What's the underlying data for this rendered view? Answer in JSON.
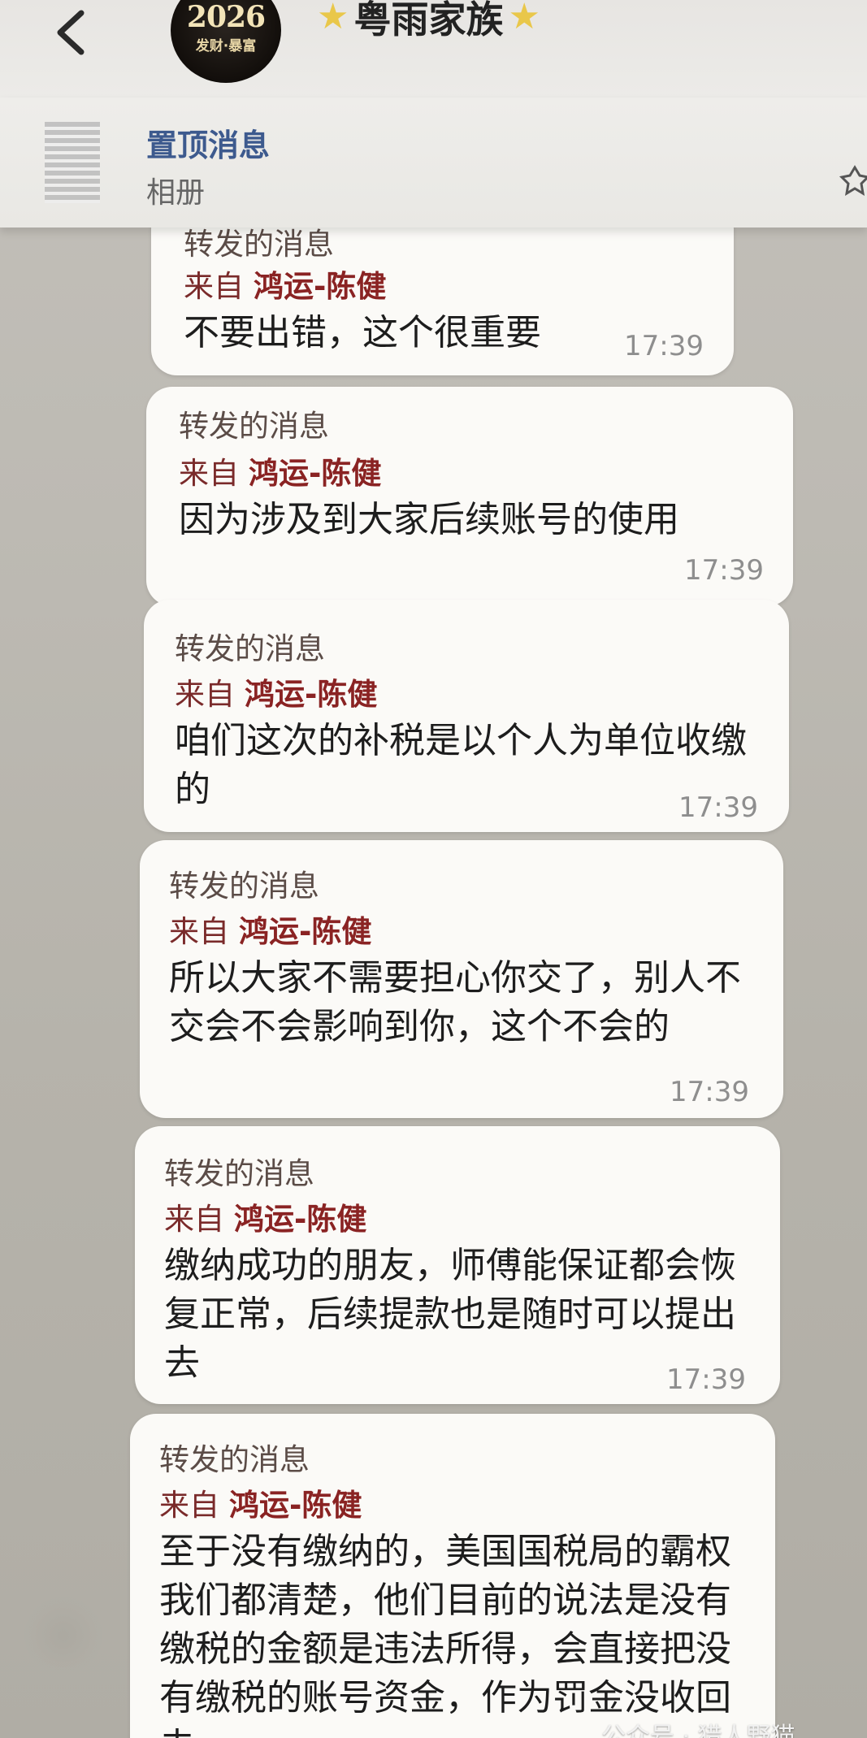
{
  "header": {
    "back_icon": "chevron-left-icon",
    "avatar": {
      "year": "2026",
      "slogan": "发财·暴富"
    },
    "title": "粤雨家族",
    "title_decor_icon": "star-icon"
  },
  "pinned": {
    "title": "置顶消息",
    "subtitle": "相册",
    "icon": "pin-icon"
  },
  "messages": [
    {
      "forward_label": "转发的消息",
      "from_prefix": "来自",
      "sender": "鸿运-陈健",
      "text": "不要出错，这个很重要",
      "time": "17:39"
    },
    {
      "forward_label": "转发的消息",
      "from_prefix": "来自",
      "sender": "鸿运-陈健",
      "text": "因为涉及到大家后续账号的使用",
      "time": "17:39"
    },
    {
      "forward_label": "转发的消息",
      "from_prefix": "来自",
      "sender": "鸿运-陈健",
      "text": "咱们这次的补税是以个人为单位收缴的",
      "time": "17:39"
    },
    {
      "forward_label": "转发的消息",
      "from_prefix": "来自",
      "sender": "鸿运-陈健",
      "text": "所以大家不需要担心你交了，别人不交会不会影响到你，这个不会的",
      "time": "17:39"
    },
    {
      "forward_label": "转发的消息",
      "from_prefix": "来自",
      "sender": "鸿运-陈健",
      "text": "缴纳成功的朋友，师傅能保证都会恢复正常，后续提款也是随时可以提出去",
      "time": "17:39"
    },
    {
      "forward_label": "转发的消息",
      "from_prefix": "来自",
      "sender": "鸿运-陈健",
      "text": "至于没有缴纳的，美国国税局的霸权我们都清楚，他们目前的说法是没有缴税的金额是违法所得，会直接把没有缴税的账号资金，作为罚金没收回去",
      "time": ""
    }
  ],
  "watermark": "公众号 · 猎人野猫",
  "colors": {
    "forward_label": "#5b4c47",
    "sender": "#8a2323",
    "pinned_title": "#3d5a8e",
    "bubble": "#fbfaf7"
  }
}
